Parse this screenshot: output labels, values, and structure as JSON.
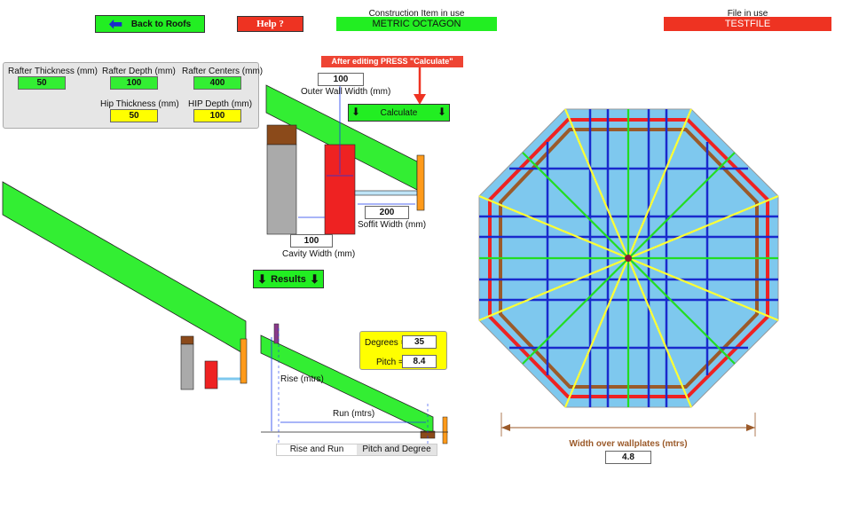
{
  "header": {
    "back_label": "Back to Roofs",
    "help_label": "Help ?",
    "construction_caption": "Construction Item in use",
    "construction_value": "METRIC OCTAGON",
    "file_caption": "File in use",
    "file_value": "TESTFILE"
  },
  "params": {
    "rafter_thickness_label": "Rafter Thickness (mm)",
    "rafter_thickness": "50",
    "rafter_depth_label": "Rafter Depth (mm)",
    "rafter_depth": "100",
    "rafter_centers_label": "Rafter Centers (mm)",
    "rafter_centers": "400",
    "hip_thickness_label": "Hip Thickness (mm)",
    "hip_thickness": "50",
    "hip_depth_label": "HIP Depth (mm)",
    "hip_depth": "100"
  },
  "section": {
    "notice": "After editing PRESS \"Calculate\"",
    "outer_wall_value": "100",
    "outer_wall_label": "Outer Wall Width (mm)",
    "calculate_label": "Calculate",
    "soffit_value": "200",
    "soffit_label": "Soffit Width (mm)",
    "cavity_value": "100",
    "cavity_label": "Cavity Width (mm)"
  },
  "results": {
    "results_label": "Results",
    "degrees_label": "Degrees =",
    "degrees_value": "35",
    "pitch_label": "Pitch =",
    "pitch_value": "8.4",
    "rise_label": "Rise (mtrs)",
    "run_label": "Run (mtrs)",
    "tab_rise_run": "Rise and Run",
    "tab_pitch_degree": "Pitch and Degree"
  },
  "plan": {
    "width_label": "Width over wallplates (mtrs)",
    "width_value": "4.8"
  },
  "colors": {
    "accent_green": "#22ee22",
    "accent_red": "#ee3322",
    "input_yellow": "#ffff00",
    "plan_fill": "#7ec8ee",
    "wallplate_brown": "#9b5a2a",
    "hip_yellow": "#ffff33"
  }
}
